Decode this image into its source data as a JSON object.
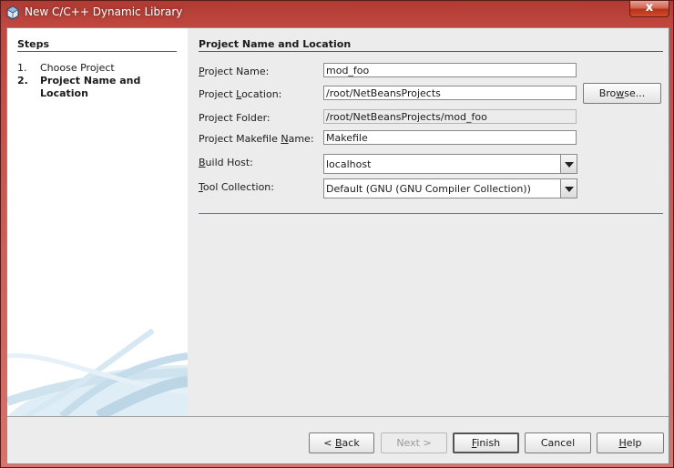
{
  "window": {
    "title": "New C/C++ Dynamic Library",
    "close_label": "x"
  },
  "steps": {
    "title": "Steps",
    "items": [
      {
        "num": "1.",
        "label": "Choose Project"
      },
      {
        "num": "2.",
        "label": "Project Name and Location"
      }
    ]
  },
  "content": {
    "title": "Project Name and Location",
    "fields": {
      "project_name": {
        "label_pre": "",
        "label_ul": "P",
        "label_post": "roject Name:",
        "value": "mod_foo"
      },
      "project_location": {
        "label_pre": "Project ",
        "label_ul": "L",
        "label_post": "ocation:",
        "value": "/root/NetBeansProjects"
      },
      "project_folder": {
        "label": "Project Folder:",
        "value": "/root/NetBeansProjects/mod_foo"
      },
      "makefile": {
        "label_pre": "Project Makefile ",
        "label_ul": "N",
        "label_post": "ame:",
        "value": "Makefile"
      },
      "build_host": {
        "label_pre": "",
        "label_ul": "B",
        "label_post": "uild Host:",
        "value": "localhost"
      },
      "tool_collection": {
        "label_pre": "",
        "label_ul": "T",
        "label_post": "ool Collection:",
        "value": "Default (GNU (GNU Compiler Collection))"
      }
    },
    "browse_label_pre": "Bro",
    "browse_label_ul": "w",
    "browse_label_post": "se..."
  },
  "buttons": {
    "back": {
      "pre": "< ",
      "ul": "B",
      "post": "ack"
    },
    "next": "Next >",
    "finish": {
      "pre": "",
      "ul": "F",
      "post": "inish"
    },
    "cancel": "Cancel",
    "help": {
      "pre": "",
      "ul": "H",
      "post": "elp"
    }
  },
  "colors": {
    "title_bar": "#c04a41",
    "panel_bg": "#ececec",
    "separator": "#5e7c9a"
  }
}
